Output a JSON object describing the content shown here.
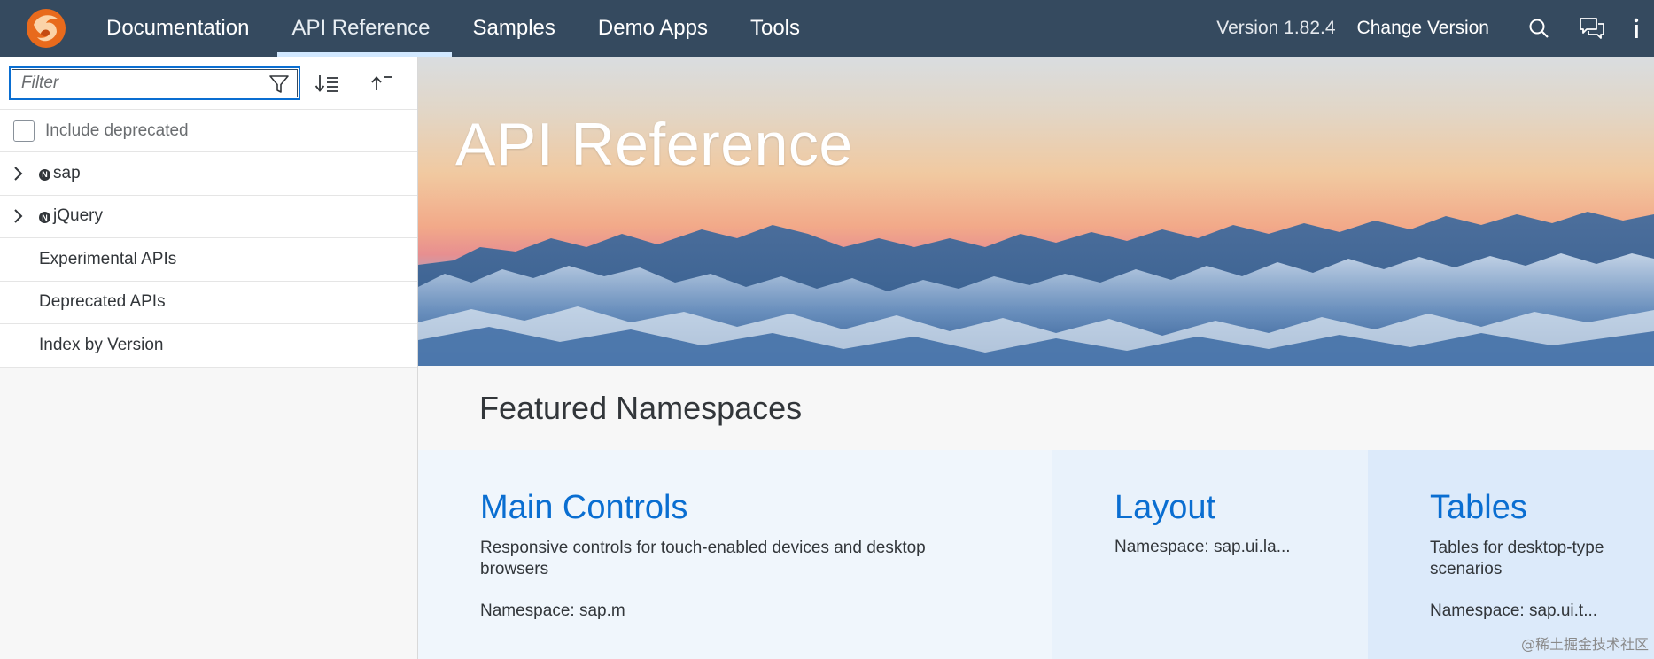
{
  "nav": {
    "items": [
      {
        "label": "Documentation"
      },
      {
        "label": "API Reference",
        "active": true
      },
      {
        "label": "Samples"
      },
      {
        "label": "Demo Apps"
      },
      {
        "label": "Tools"
      }
    ],
    "version": "Version 1.82.4",
    "change_version": "Change Version",
    "icons": [
      "search-icon",
      "feedback-icon",
      "info-icon"
    ]
  },
  "sidebar": {
    "filter_placeholder": "Filter",
    "filter_value": "",
    "include_deprecated": {
      "label": "Include deprecated",
      "checked": false
    },
    "tree": [
      {
        "label": "sap",
        "expandable": true,
        "namespace": true,
        "badge": "N"
      },
      {
        "label": "jQuery",
        "expandable": true,
        "namespace": true,
        "badge": "N"
      },
      {
        "label": "Experimental APIs",
        "expandable": false
      },
      {
        "label": "Deprecated APIs",
        "expandable": false
      },
      {
        "label": "Index by Version",
        "expandable": false
      }
    ]
  },
  "hero": {
    "title": "API Reference"
  },
  "featured": {
    "title": "Featured Namespaces",
    "cards": [
      {
        "title": "Main Controls",
        "description": "Responsive controls for touch-enabled devices and desktop browsers",
        "namespace": "Namespace: sap.m"
      },
      {
        "title": "Layout",
        "description": "",
        "namespace": "Namespace: sap.ui.la..."
      },
      {
        "title": "Tables",
        "description": "Tables for desktop-type scenarios",
        "namespace": "Namespace: sap.ui.t..."
      }
    ]
  },
  "watermark": "@稀土掘金技术社区",
  "colors": {
    "shell": "#354a5f",
    "accent": "#0a6ed1",
    "logo": "#f0ab00"
  }
}
